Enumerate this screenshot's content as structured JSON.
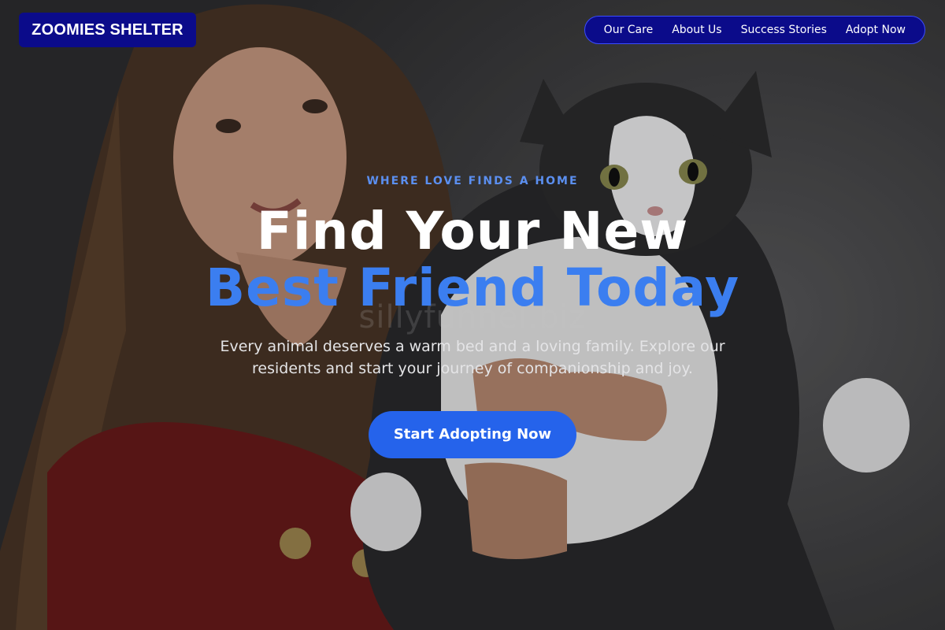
{
  "header": {
    "logo_text": "ZOOMIES SHELTER",
    "nav": [
      {
        "label": "Our Care"
      },
      {
        "label": "About Us"
      },
      {
        "label": "Success Stories"
      },
      {
        "label": "Adopt Now"
      }
    ]
  },
  "hero": {
    "eyebrow": "WHERE LOVE FINDS A HOME",
    "headline_line1": "Find Your New",
    "headline_line2": "Best Friend Today",
    "subtext": "Every animal deserves a warm bed and a loving family. Explore our residents and start your journey of companionship and joy.",
    "cta_label": "Start Adopting Now",
    "watermark": "sillyfunnel.biz"
  },
  "colors": {
    "brand_navy": "#0b0b8a",
    "accent_blue": "#3b7ef0",
    "cta_blue": "#2563eb",
    "eyebrow_blue": "#5b8ff0"
  }
}
